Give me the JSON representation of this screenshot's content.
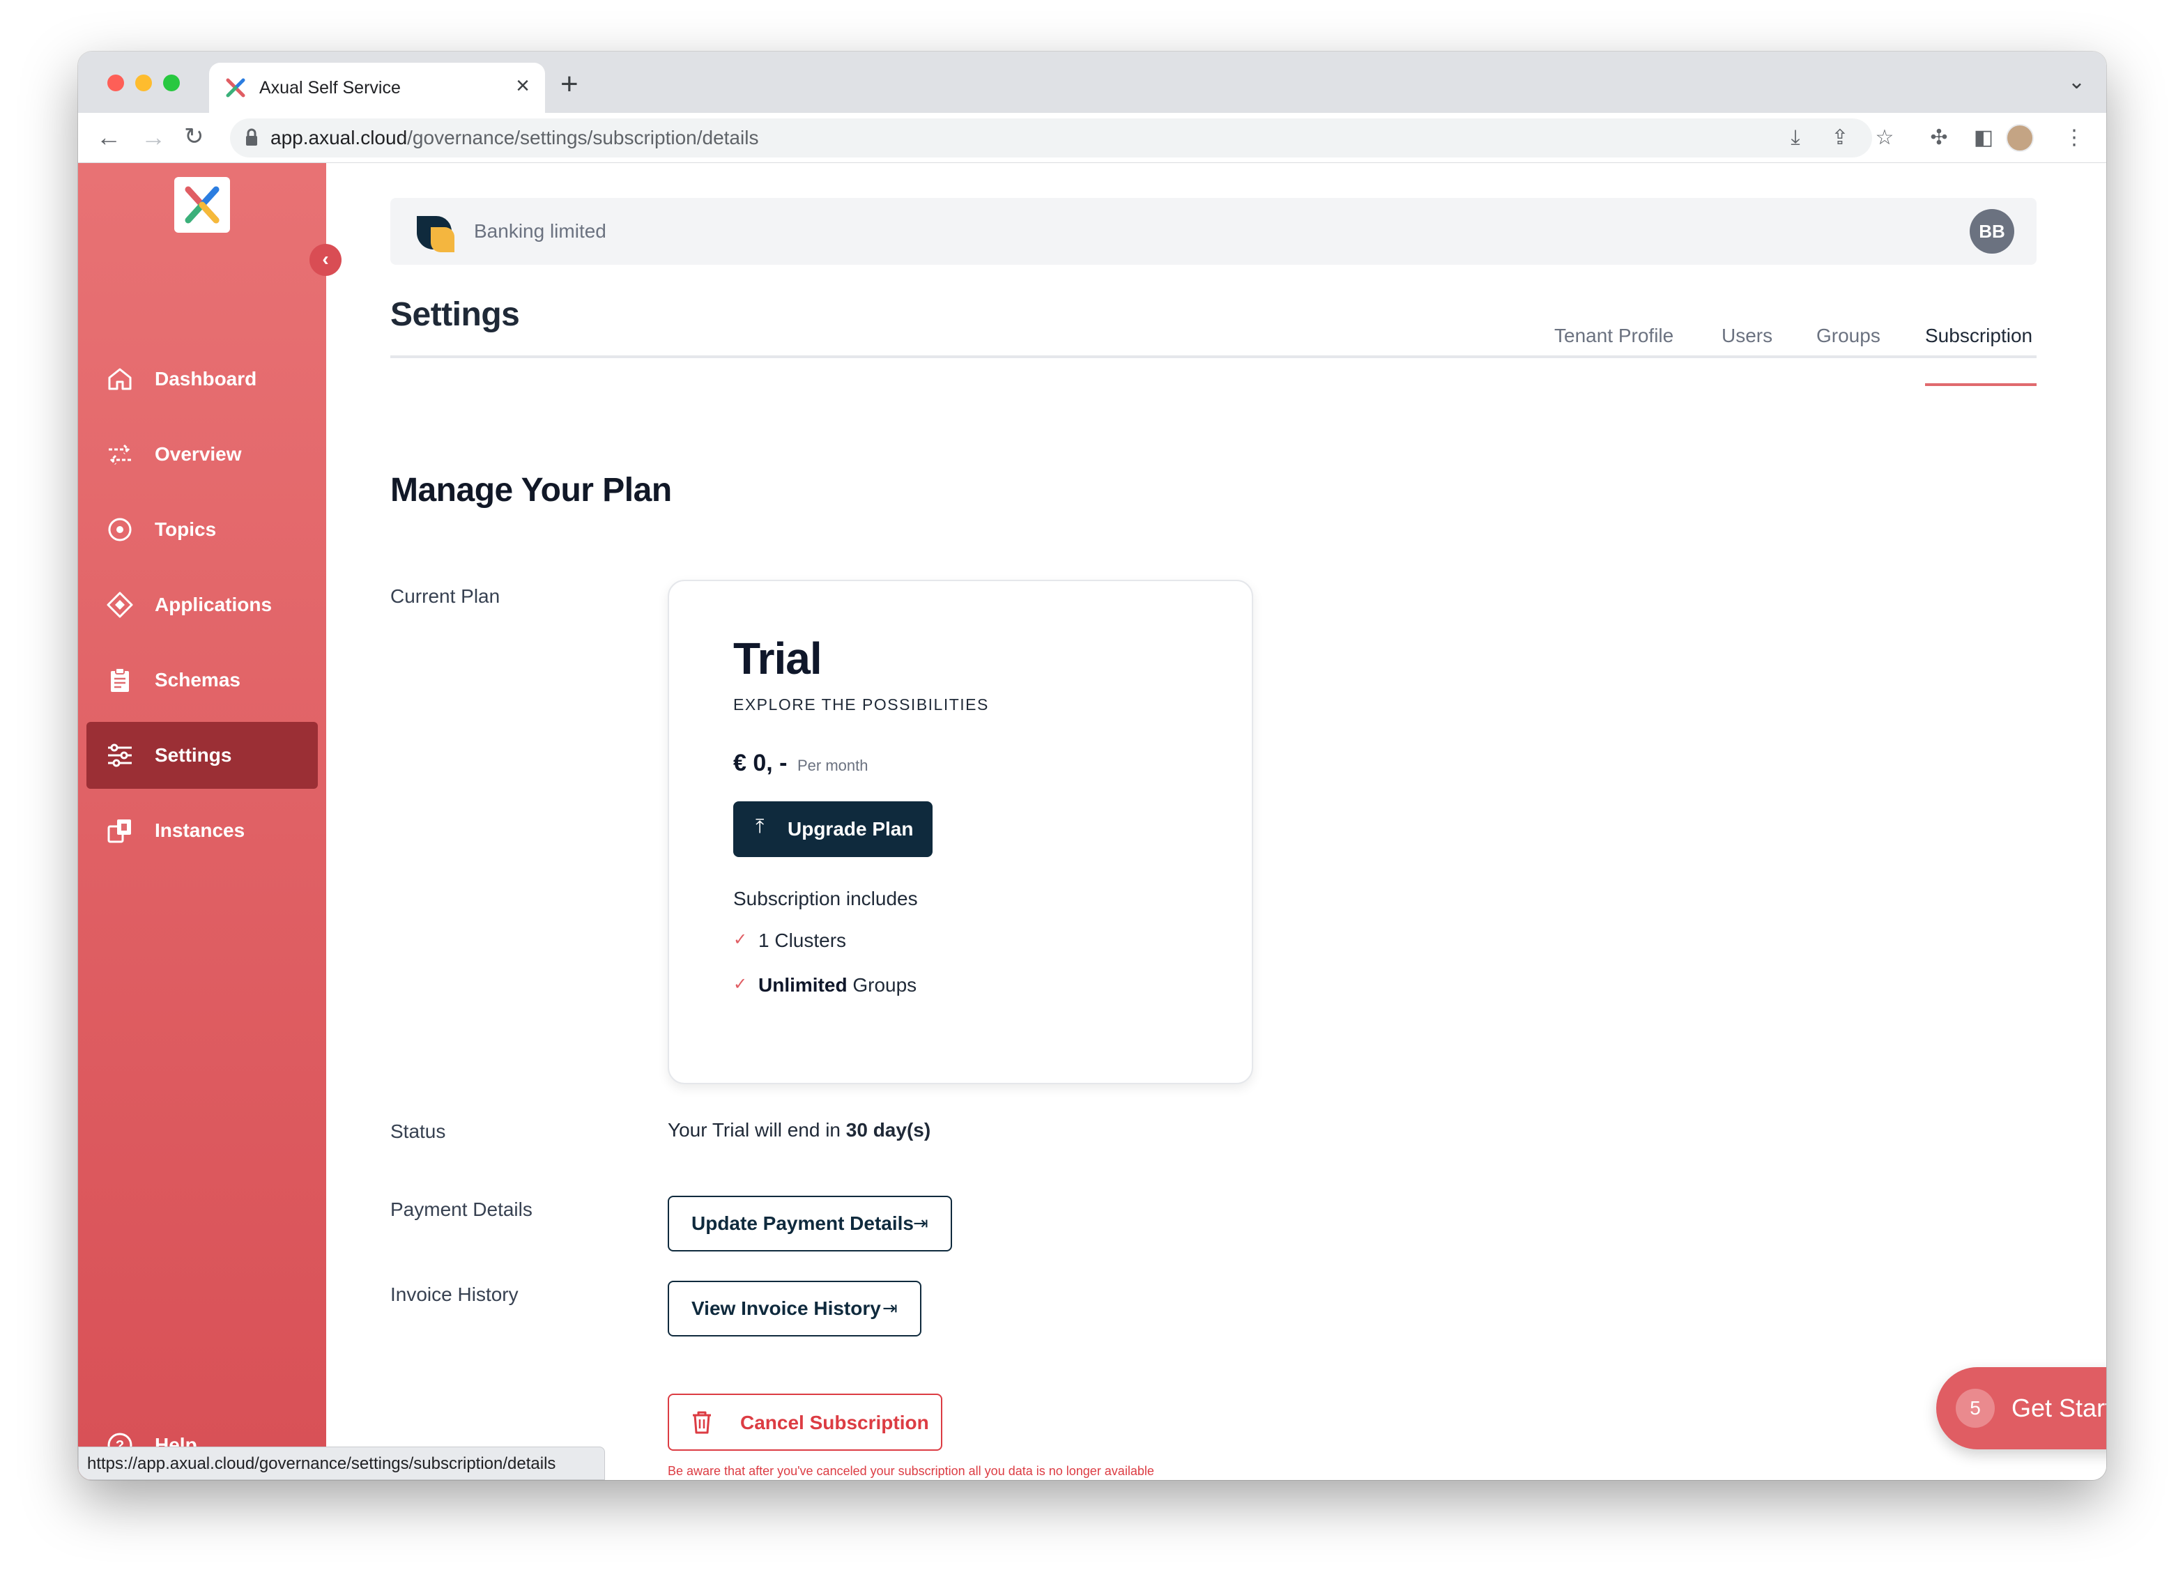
{
  "browser": {
    "tab_title": "Axual Self Service",
    "new_tab_symbol": "+",
    "close_symbol": "×",
    "url_domain": "app.axual.cloud",
    "url_path": "/governance/settings/subscription/details",
    "status_url": "https://app.axual.cloud/governance/settings/subscription/details"
  },
  "sidebar": {
    "collapse_symbol": "‹",
    "items": [
      {
        "label": "Dashboard",
        "icon": "home-icon"
      },
      {
        "label": "Overview",
        "icon": "arrows-icon"
      },
      {
        "label": "Topics",
        "icon": "target-icon"
      },
      {
        "label": "Applications",
        "icon": "diamond-icon"
      },
      {
        "label": "Schemas",
        "icon": "clipboard-icon"
      },
      {
        "label": "Settings",
        "icon": "sliders-icon",
        "active": true
      },
      {
        "label": "Instances",
        "icon": "instances-icon"
      }
    ],
    "help_label": "Help"
  },
  "tenant": {
    "name": "Banking limited",
    "avatar_initials": "BB"
  },
  "page": {
    "title": "Settings",
    "tabs": [
      {
        "label": "Tenant Profile",
        "active": false
      },
      {
        "label": "Users",
        "active": false
      },
      {
        "label": "Groups",
        "active": false
      },
      {
        "label": "Subscription",
        "active": true
      }
    ]
  },
  "plan": {
    "section_title": "Manage Your Plan",
    "current_plan_label": "Current Plan",
    "name": "Trial",
    "tagline": "EXPLORE THE POSSIBILITIES",
    "price": "€ 0, -",
    "per": "Per month",
    "upgrade_label": "Upgrade Plan",
    "includes_title": "Subscription includes",
    "includes": [
      {
        "strong": "",
        "text": "1 Clusters"
      },
      {
        "strong": "Unlimited",
        "text": " Groups"
      }
    ]
  },
  "status": {
    "label": "Status",
    "text_prefix": "Your Trial will end in ",
    "text_strong": "30 day(s)"
  },
  "payment": {
    "label": "Payment Details",
    "button": "Update Payment Details"
  },
  "invoice": {
    "label": "Invoice History",
    "button": "View Invoice History"
  },
  "cancel": {
    "button": "Cancel Subscription",
    "warning": "Be aware that after you've canceled your subscription all you data is no longer available and you won't be able to make use of Axual any longer."
  },
  "get_started": {
    "count": "5",
    "label": "Get Started"
  },
  "colors": {
    "sidebar_top": "#e87274",
    "sidebar_bottom": "#d85056",
    "sidebar_active": "#9b2f35",
    "primary_dark": "#0f2a3d",
    "danger": "#dc3c43",
    "accent": "#e05d63"
  }
}
